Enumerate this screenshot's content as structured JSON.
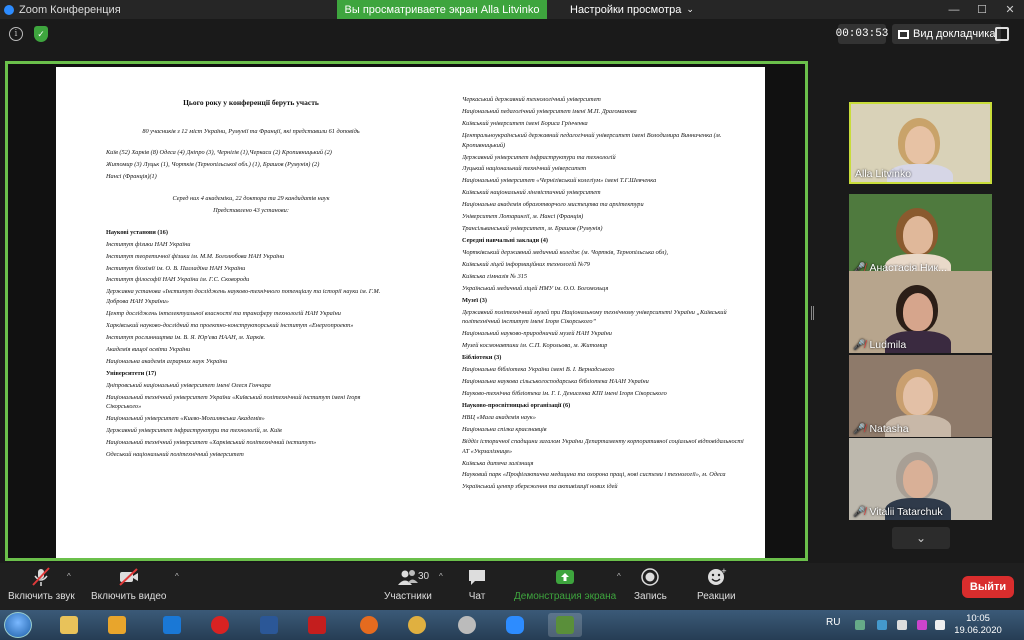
{
  "window": {
    "title": "Zoom Конференция"
  },
  "banner": {
    "sharing_text": "Вы просматриваете экран Alla Litvinko",
    "view_options": "Настройки просмотра"
  },
  "topbar": {
    "timer": "00:03:53",
    "speaker_view": "Вид докладчика"
  },
  "document": {
    "left": [
      {
        "text": "Цього року у конференції беруть участь",
        "style": "heading"
      },
      {
        "text": "80 учасників з 12 міст України, Румунії та Франції, які представили 61 доповідь",
        "style": "center-gap"
      },
      {
        "text": "Київ (52) Харків (8) Одеса (4) Дніпро (3), Чернігів (1),Черкаси (2) Кропивницький (2)",
        "style": "plain"
      },
      {
        "text": "Житомир (3) Луцьк (1), Чортків (Тернопільської обл.) (1), Брашов (Румунія) (2)",
        "style": "plain"
      },
      {
        "text": "Нансі (Франція)(1)",
        "style": "gap"
      },
      {
        "text": "Серед них 4 академіки, 22 доктора та 29 кандидатів наук",
        "style": "center"
      },
      {
        "text": "Представлено 43 установи:",
        "style": "center-gap"
      },
      {
        "text": "Наукові установи (16)",
        "style": "sec"
      },
      {
        "text": "Інститут фізики НАН України",
        "style": "plain"
      },
      {
        "text": "Інститут теоретичної фізики ім. М.М. Боголюбова НАН України",
        "style": "plain"
      },
      {
        "text": "Інститут біохімії ім. О. В. Палладіна НАН України",
        "style": "plain"
      },
      {
        "text": "Інститут філософії НАН України ім. Г.С. Сковороди",
        "style": "plain"
      },
      {
        "text": "Державна установа «Інститут досліджень науково-технічного потенціалу та історії науки ім. Г.М. Доброва НАН України»",
        "style": "wrap"
      },
      {
        "text": "Центр досліджень інтелектуальної власності та трансферу технологій НАН України",
        "style": "plain"
      },
      {
        "text": "Харківський науково-дослідний та проектно-конструкторський інститут «Енергопроект»",
        "style": "wrap"
      },
      {
        "text": "Інститут рослинництва ім. В. Я. Юр'єва НААН, м. Харків.",
        "style": "plain"
      },
      {
        "text": "Академія вищої освіти України",
        "style": "plain"
      },
      {
        "text": "Національна академія аграрних наук України",
        "style": "plain"
      },
      {
        "text": "Університети (17)",
        "style": "sec"
      },
      {
        "text": "Дніпровський національний університет імені Олеся Гончара",
        "style": "plain"
      },
      {
        "text": "Національний технічний університет України «Київський політехнічний інститут імені Ігоря Сікорського»",
        "style": "wrap"
      },
      {
        "text": "Національний університет «Києво-Могилянська Академія»",
        "style": "plain"
      },
      {
        "text": "Державний університет інфраструктури та технологій, м. Київ",
        "style": "plain"
      },
      {
        "text": "Національний технічний університет «Харківський політехнічний інститут»",
        "style": "plain"
      },
      {
        "text": "Одеський національний політехнічний університет",
        "style": "plain"
      }
    ],
    "right": [
      {
        "text": "Черкаський державний технологічний університет",
        "style": "plain"
      },
      {
        "text": "Національний педагогічний університет імені М.П. Драгоманова",
        "style": "plain"
      },
      {
        "text": "Київський університет імені Бориса Грінченка",
        "style": "plain"
      },
      {
        "text": "Центральноукраїнський державний педагогічний університет імені Володимира Винниченка (м. Кропивницький)",
        "style": "wrap"
      },
      {
        "text": "Державний університет інфраструктури та технологій",
        "style": "plain"
      },
      {
        "text": "Луцький національний технічний університет",
        "style": "plain"
      },
      {
        "text": "Національний університет «Чернігівський колегіум» імені Т.Г.Шевченка",
        "style": "plain"
      },
      {
        "text": "Київський національний лінгвістичний університет",
        "style": "plain"
      },
      {
        "text": "Національна академія образотворчого мистецтва та архітектури",
        "style": "plain"
      },
      {
        "text": "Університет Лотарингії, м. Нансі (Франція)",
        "style": "plain"
      },
      {
        "text": "Трансільванський університет, м. Брашов (Румунія)",
        "style": "plain"
      },
      {
        "text": "Середні навчальні заклади (4)",
        "style": "sec"
      },
      {
        "text": "Чортківський державний медичний коледж (м. Чортків, Тернопільська обл),",
        "style": "plain"
      },
      {
        "text": "Київський ліцей інформаційних технологій №79",
        "style": "plain"
      },
      {
        "text": "Київська гімназія № 315",
        "style": "plain"
      },
      {
        "text": "Український медичний ліцей НМУ ім. О.О. Богомольця",
        "style": "plain"
      },
      {
        "text": "Музеї (3)",
        "style": "sec"
      },
      {
        "text": "Державний політехнічний музей при Національному технічному університеті України „Київський політехнічний інститут імені Ігоря Сікорського”",
        "style": "wrap"
      },
      {
        "text": "Національний науково-природничий музей НАН України",
        "style": "plain"
      },
      {
        "text": "Музей космонавтики ім. С.П. Корольова, м. Житомир",
        "style": "plain"
      },
      {
        "text": "Бібліотеки (3)",
        "style": "sec"
      },
      {
        "text": "Національна бібліотека України імені В. І. Вернадського",
        "style": "plain"
      },
      {
        "text": "Національна наукова сільськогосподарська бібліотека НААН України",
        "style": "plain"
      },
      {
        "text": "Науково-технічна бібліотека ім. Г. І. Денисенка КПІ імені Ігоря Сікорського",
        "style": "plain"
      },
      {
        "text": "Науково-просвітницькі організації (6)",
        "style": "sec"
      },
      {
        "text": "НВЦ «Мала академія наук»",
        "style": "plain"
      },
      {
        "text": "Національна спілка краєзнавців",
        "style": "plain"
      },
      {
        "text": "Відділ історичної спадщини загалом України Департаменту корпоративної соціальної відповідальності АТ «Укрзалізниця»",
        "style": "wrap"
      },
      {
        "text": "Київська дитяча залізниця",
        "style": "plain"
      },
      {
        "text": "Науковий парк «Профілактична медицина та охорона праці, нові системи і технології», м. Одеса",
        "style": "wrap"
      },
      {
        "text": "Український центр збереження та активізації нових ідей",
        "style": "plain"
      }
    ]
  },
  "participants": [
    {
      "name": "Alla Litvinko",
      "muted": false,
      "active": true,
      "bg": "#d9d2b8",
      "skin": "#e7c2a4",
      "hair": "#c9a36a",
      "shirt": "#d6d6e6"
    },
    {
      "name": "Анастасія Ник...",
      "muted": true,
      "active": false,
      "bg": "#4f7a3e",
      "skin": "#e0b89a",
      "hair": "#8a5a2e",
      "shirt": "#e9d9c9"
    },
    {
      "name": "Ludmila",
      "muted": true,
      "active": false,
      "bg": "#b7a58d",
      "skin": "#d6a58c",
      "hair": "#2b1e17",
      "shirt": "#3a2a40"
    },
    {
      "name": "Natasha",
      "muted": true,
      "active": false,
      "bg": "#8e7a6a",
      "skin": "#e3c0a6",
      "hair": "#c99f6f",
      "shirt": "#c8b8a8"
    },
    {
      "name": "Vitalii Tatarchuk",
      "muted": true,
      "active": false,
      "bg": "#bdb8ad",
      "skin": "#d9b097",
      "hair": "#a89f95",
      "shirt": "#2f3a4a"
    }
  ],
  "toolbar": {
    "audio": "Включить звук",
    "video": "Включить видео",
    "participants": "Участники",
    "participants_count": "30",
    "chat": "Чат",
    "share": "Демонстрация экрана",
    "record": "Запись",
    "reactions": "Реакции",
    "leave": "Выйти"
  },
  "taskbar": {
    "lang": "RU",
    "time": "10:05",
    "date": "19.06.2020"
  },
  "colors": {
    "share_green": "#3ea53e",
    "active_border": "#c9dd3a",
    "leave_red": "#d92d2d"
  }
}
